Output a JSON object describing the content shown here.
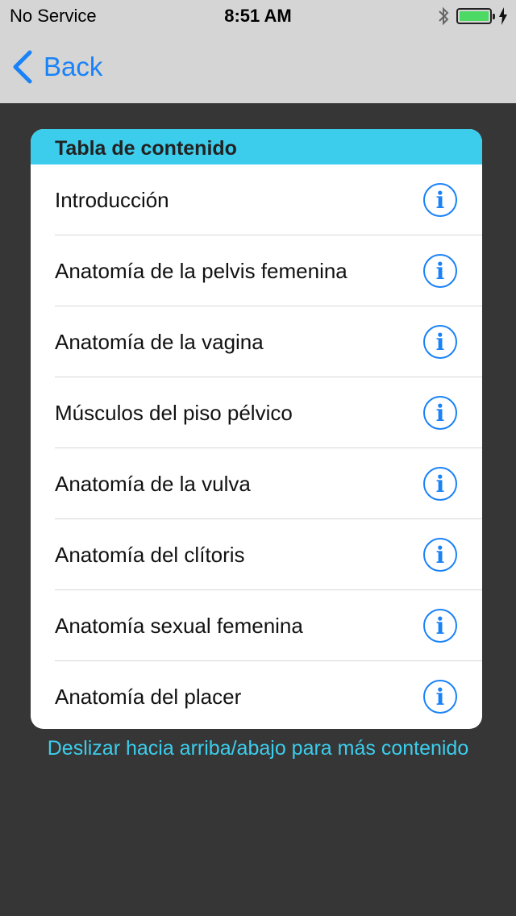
{
  "status_bar": {
    "carrier": "No Service",
    "time": "8:51 AM",
    "icons": [
      "bluetooth-icon",
      "battery-icon",
      "charging-bolt-icon"
    ]
  },
  "nav": {
    "back_label": "Back"
  },
  "toc": {
    "title": "Tabla de contenido",
    "items": [
      {
        "label": "Introducción"
      },
      {
        "label": "Anatomía de la pelvis femenina"
      },
      {
        "label": "Anatomía de la vagina"
      },
      {
        "label": "Músculos del piso pélvico"
      },
      {
        "label": "Anatomía de la vulva"
      },
      {
        "label": "Anatomía del clítoris"
      },
      {
        "label": "Anatomía sexual femenina"
      },
      {
        "label": "Anatomía del placer"
      }
    ]
  },
  "hint": "Deslizar hacia arriba/abajo para más contenido",
  "colors": {
    "accent_blue": "#1a82f7",
    "header_cyan": "#3ccdec",
    "background": "#363636",
    "battery_green": "#4cd964"
  }
}
